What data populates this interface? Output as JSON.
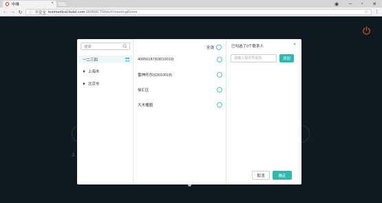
{
  "browser": {
    "tab_title": "中维",
    "url_secure_label": "不安全",
    "url_host": "testmedical.butel.com",
    "url_path": ":96/BMCTWeb/#/meetingRoom"
  },
  "background": {
    "left_label": "上"
  },
  "modal": {
    "search_placeholder": "搜索",
    "tree": {
      "selected_label": "一二三四",
      "nodes": [
        "上海市",
        "北京市"
      ]
    },
    "select_all_label": "全选",
    "items": [
      "40056187(63010019)",
      "雷神托尔(63010018)",
      "徐汇区",
      "大木桶圈"
    ],
    "right": {
      "title": "已勾选了0个联系人",
      "input_placeholder": "请输入视讯号添加",
      "add_label": "添加",
      "cancel_label": "取消",
      "confirm_label": "确定"
    }
  },
  "colors": {
    "accent": "#2fb8b0",
    "power": "#e0462f"
  }
}
